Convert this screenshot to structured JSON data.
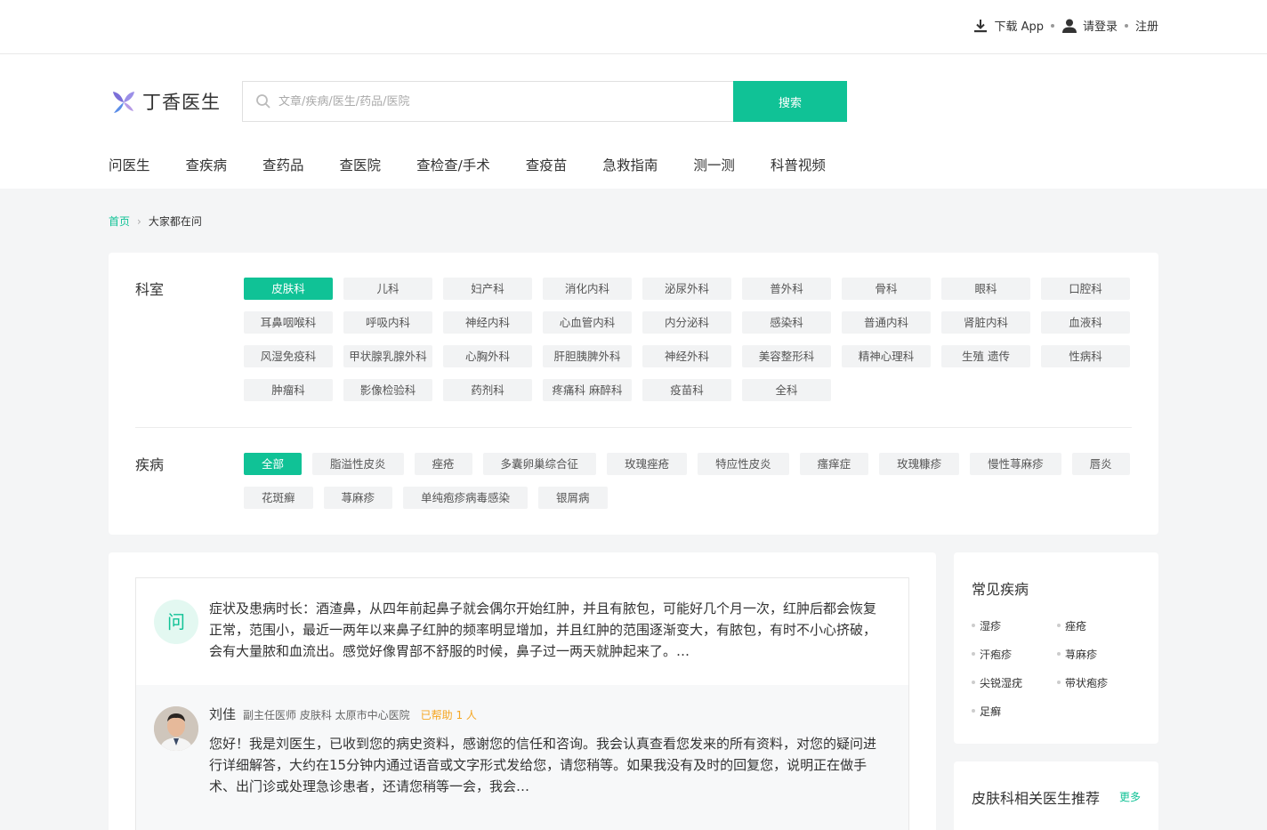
{
  "topbar": {
    "download": "下载 App",
    "login": "请登录",
    "register": "注册"
  },
  "header": {
    "logo_text": "丁香医生",
    "search_placeholder": "文章/疾病/医生/药品/医院",
    "search_button": "搜索",
    "nav": [
      "问医生",
      "查疾病",
      "查药品",
      "查医院",
      "查检查/手术",
      "查疫苗",
      "急救指南",
      "测一测",
      "科普视频"
    ]
  },
  "breadcrumb": {
    "home": "首页",
    "current": "大家都在问"
  },
  "filters": {
    "dept_label": "科室",
    "departments": [
      "皮肤科",
      "儿科",
      "妇产科",
      "消化内科",
      "泌尿外科",
      "普外科",
      "骨科",
      "眼科",
      "口腔科",
      "耳鼻咽喉科",
      "呼吸内科",
      "神经内科",
      "心血管内科",
      "内分泌科",
      "感染科",
      "普通内科",
      "肾脏内科",
      "血液科",
      "风湿免疫科",
      "甲状腺乳腺外科",
      "心胸外科",
      "肝胆胰脾外科",
      "神经外科",
      "美容整形科",
      "精神心理科",
      "生殖 遗传",
      "性病科",
      "肿瘤科",
      "影像检验科",
      "药剂科",
      "疼痛科 麻醉科",
      "疫苗科",
      "全科"
    ],
    "disease_label": "疾病",
    "diseases": [
      "全部",
      "脂溢性皮炎",
      "痤疮",
      "多囊卵巢综合征",
      "玫瑰痤疮",
      "特应性皮炎",
      "瘙痒症",
      "玫瑰糠疹",
      "慢性荨麻疹",
      "唇炎",
      "花斑癣",
      "荨麻疹",
      "单纯疱疹病毒感染",
      "银屑病"
    ]
  },
  "question": {
    "badge": "问",
    "text": "症状及患病时长：酒渣鼻，从四年前起鼻子就会偶尔开始红肿，并且有脓包，可能好几个月一次，红肿后都会恢复正常，范围小，最近一两年以来鼻子红肿的频率明显增加，并且红肿的范围逐渐变大，有脓包，有时不小心挤破，会有大量脓和血流出。感觉好像胃部不舒服的时候，鼻子过一两天就肿起来了。…"
  },
  "answer": {
    "doctor_name": "刘佳",
    "doctor_meta": "副主任医师 皮肤科 太原市中心医院",
    "helped": "已帮助 1 人",
    "text": "您好！我是刘医生，已收到您的病史资料，感谢您的信任和咨询。我会认真查看您发来的所有资料，对您的疑问进行详细解答，大约在15分钟内通过语音或文字形式发给您，请您稍等。如果我没有及时的回复您，说明正在做手术、出门诊或处理急诊患者，还请您稍等一会，我会…"
  },
  "sidebar": {
    "common_title": "常见疾病",
    "common_list": [
      "湿疹",
      "痤疮",
      "汗疱疹",
      "荨麻疹",
      "尖锐湿疣",
      "带状疱疹",
      "足癣"
    ],
    "doctors_title": "皮肤科相关医生推荐",
    "more": "更多"
  },
  "colors": {
    "accent": "#10c296",
    "help": "#f5a623"
  }
}
